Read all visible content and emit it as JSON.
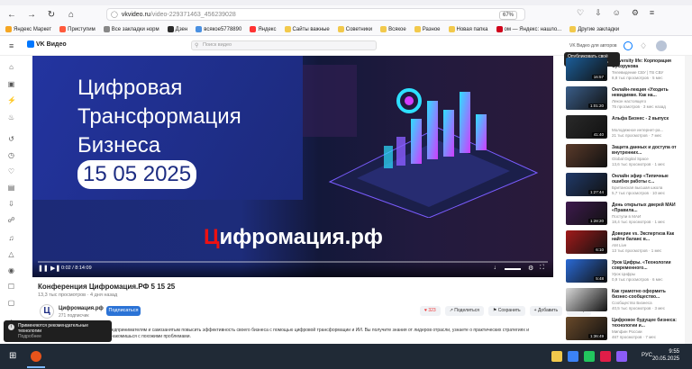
{
  "browser": {
    "url_host": "vkvideo.ru",
    "url_path": "/video-229371463_456239028",
    "zoom": "67%"
  },
  "bookmarks": [
    "Яндекс Маркет",
    "Приступим",
    "Все закладки норм",
    "Дзен",
    "всякое5778890",
    "Яндекс",
    "Сайты важные",
    "Советники",
    "Всякое",
    "Разное",
    "Новая папка",
    "ом — Яндекс: нашло...",
    "Другие закладки"
  ],
  "vk": {
    "logo_text": "VK Видео",
    "search_placeholder": "Поиск видео",
    "header_right": "VK Видео для авторов",
    "tooltip": "Опубликовать своё видео можно здесь"
  },
  "player": {
    "title_lines": [
      "Цифровая",
      "Трансформация",
      "Бизнеса"
    ],
    "date": "15 05 2025",
    "brand_mark": "Ц",
    "brand_rest": "ифромация.рф",
    "time": "0:02 / 8:14:09"
  },
  "video": {
    "title": "Конференция Цифромация.РФ 5 15 25",
    "meta": "13,3 тыс просмотров · 4 дня назад",
    "channel": "Цифромация.рф",
    "subs": "271 подписчик",
    "subscribe": "Подписаться",
    "likes": "323",
    "share": "Поделиться",
    "save": "Сохранить",
    "add": "Добавить",
    "more": "Ещё",
    "description": "...предпринимателям и самозанятым повысить эффективность своего бизнеса с помощью цифровой трансформации и ИИ. Вы получите знания от лидеров отрасли, узнаете о практических стратегиях и ...ознакомишься с похожими проблемами."
  },
  "toast": {
    "title": "Применяются рекомендательные технологии",
    "link": "Подробнее"
  },
  "recs": [
    {
      "title": "University life: Корпорация Сухорукова",
      "channel": "Телевидение СВУ | ТВ СВУ",
      "views": "8,8 тыс просмотров · 5 мес",
      "duration": "16:57",
      "color": "#1b5e9a"
    },
    {
      "title": "Онлайн-лекция «Уходить невидимке. Как на...",
      "channel": "Лекон настоящего",
      "views": "75 просмотров · 3 мес назад",
      "duration": "1:01:20",
      "color": "#3a5e8a"
    },
    {
      "title": "Альфа Бизнес - 2 выпуск",
      "channel": "Молодежное интернет-ра...",
      "views": "21 тыс просмотров · 7 мес",
      "duration": "41:40",
      "color": "#2a2a2a"
    },
    {
      "title": "Защита данных и доступа от внутренних...",
      "channel": "Global Digital Space",
      "views": "13,6 тыс просмотров · 1 мес",
      "duration": "",
      "color": "#5a3a2a"
    },
    {
      "title": "Онлайн эфир «Типичные ошибки работы с...",
      "channel": "Британская высшая школа",
      "views": "5,7 тыс просмотров · 10 мес",
      "duration": "1:27:44",
      "color": "#203a6a"
    },
    {
      "title": "День открытых дверей МАИ «Правила...",
      "channel": "Поступи в МАИ",
      "views": "18,4 тыс просмотров · 1 мес",
      "duration": "1:28:20",
      "color": "#3e1a4e"
    },
    {
      "title": "Доверие vs. Экспертиза Как найти баланс в...",
      "channel": "AM Live",
      "views": "13 тыс просмотров · 1 мес",
      "duration": "6:10",
      "color": "#a21a1a"
    },
    {
      "title": "Урок Цифры. «Технологии современного...",
      "channel": "Урок Цифры",
      "views": "0,9 тыс просмотров · 6 мес",
      "duration": "5:48",
      "color": "#2a6ad6"
    },
    {
      "title": "Как грамотно оформить бизнес-сообщество...",
      "channel": "Сообщество Бизнеса",
      "views": "40,5 тыс просмотров · 3 мес",
      "duration": "",
      "color": "#d8d8d8"
    },
    {
      "title": "Цифровое будущее бизнеса: технологии и...",
      "channel": "Миnфин России",
      "views": "467 просмотров · 7 мес",
      "duration": "1:36:49",
      "color": "#6a4a2a"
    }
  ],
  "taskbar": {
    "lang": "РУС",
    "time": "9:55",
    "date": "20.05.2025"
  }
}
